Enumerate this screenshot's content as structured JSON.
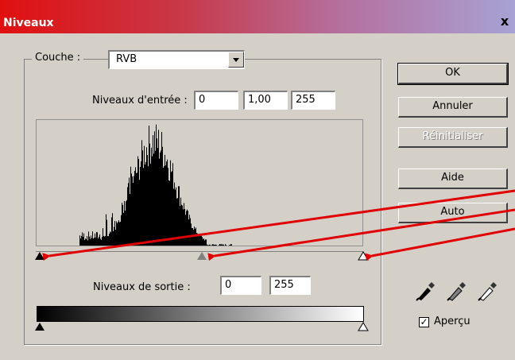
{
  "window": {
    "title": "Niveaux",
    "close_glyph": "x"
  },
  "layer": {
    "label": "Couche :",
    "selected": "RVB"
  },
  "input_levels": {
    "label": "Niveaux d'entrée :",
    "black": "0",
    "gamma": "1,00",
    "white": "255"
  },
  "output_levels": {
    "label": "Niveaux de sortie :",
    "black": "0",
    "white": "255"
  },
  "buttons": {
    "ok": "OK",
    "cancel": "Annuler",
    "reset": "Réinitialiser",
    "help": "Aide",
    "auto": "Auto"
  },
  "preview": {
    "label": "Aperçu",
    "checked": true,
    "check_glyph": "✓"
  },
  "histogram": {
    "description_bins": [
      0,
      0,
      0,
      0,
      0,
      0,
      0,
      0,
      0,
      0,
      0,
      0,
      0,
      0,
      0,
      0,
      0,
      0,
      0,
      0,
      0,
      0,
      0,
      0,
      0,
      0,
      0,
      0,
      0,
      0,
      0,
      0,
      0,
      0,
      0,
      0,
      0,
      0,
      0,
      0,
      0,
      0,
      0,
      0,
      0,
      0,
      0,
      0,
      0,
      0,
      0,
      0,
      0,
      0,
      0,
      0,
      0,
      0,
      0,
      0,
      0,
      0,
      0,
      0,
      0,
      0,
      0,
      0,
      0,
      0,
      0,
      0,
      0,
      0,
      0,
      0,
      0,
      0,
      0,
      0,
      0,
      0,
      0,
      0,
      0,
      0,
      0,
      0,
      0,
      0,
      0,
      0,
      0,
      0,
      0,
      0,
      0,
      0,
      0,
      0,
      0,
      0,
      0,
      0,
      0,
      0,
      0,
      0,
      0,
      0,
      0,
      0,
      0,
      0,
      0,
      0,
      0,
      0,
      0,
      0,
      0,
      0,
      0,
      0,
      0,
      0,
      0,
      0,
      0,
      0,
      0,
      0,
      0,
      0,
      0,
      0,
      0,
      0,
      0,
      0,
      0,
      0,
      0,
      0,
      0,
      0,
      0,
      0,
      0,
      0,
      0,
      0,
      0,
      0,
      0,
      0,
      0,
      0,
      0,
      0,
      0,
      0,
      0,
      0,
      0,
      0,
      0,
      0,
      0,
      0,
      0,
      0,
      0,
      0,
      0,
      0,
      0,
      0,
      0,
      0,
      0,
      0,
      0,
      0,
      0,
      0,
      0,
      0,
      0,
      0,
      0,
      0,
      0,
      0,
      0,
      0,
      0,
      0,
      0,
      0,
      0,
      0,
      0,
      0,
      0,
      0,
      0,
      0,
      0,
      0,
      0,
      0,
      0,
      0,
      0,
      0,
      0,
      0,
      0,
      0,
      0,
      0,
      0,
      0,
      0,
      0,
      0,
      0,
      0,
      0,
      0,
      0,
      0,
      0,
      0,
      0,
      0,
      0,
      0,
      0,
      0,
      0,
      0,
      0,
      0,
      0,
      0,
      0,
      0,
      0,
      0
    ]
  },
  "colors": {
    "annotation": "#e00000",
    "title_start": "#e01010",
    "title_end": "#a7a2d4",
    "dialog_bg": "#d4d0c8"
  },
  "icons": [
    "close-icon",
    "dropdown-arrow-icon",
    "eyedropper-black-icon",
    "eyedropper-gray-icon",
    "eyedropper-white-icon",
    "checkbox-check-icon"
  ]
}
